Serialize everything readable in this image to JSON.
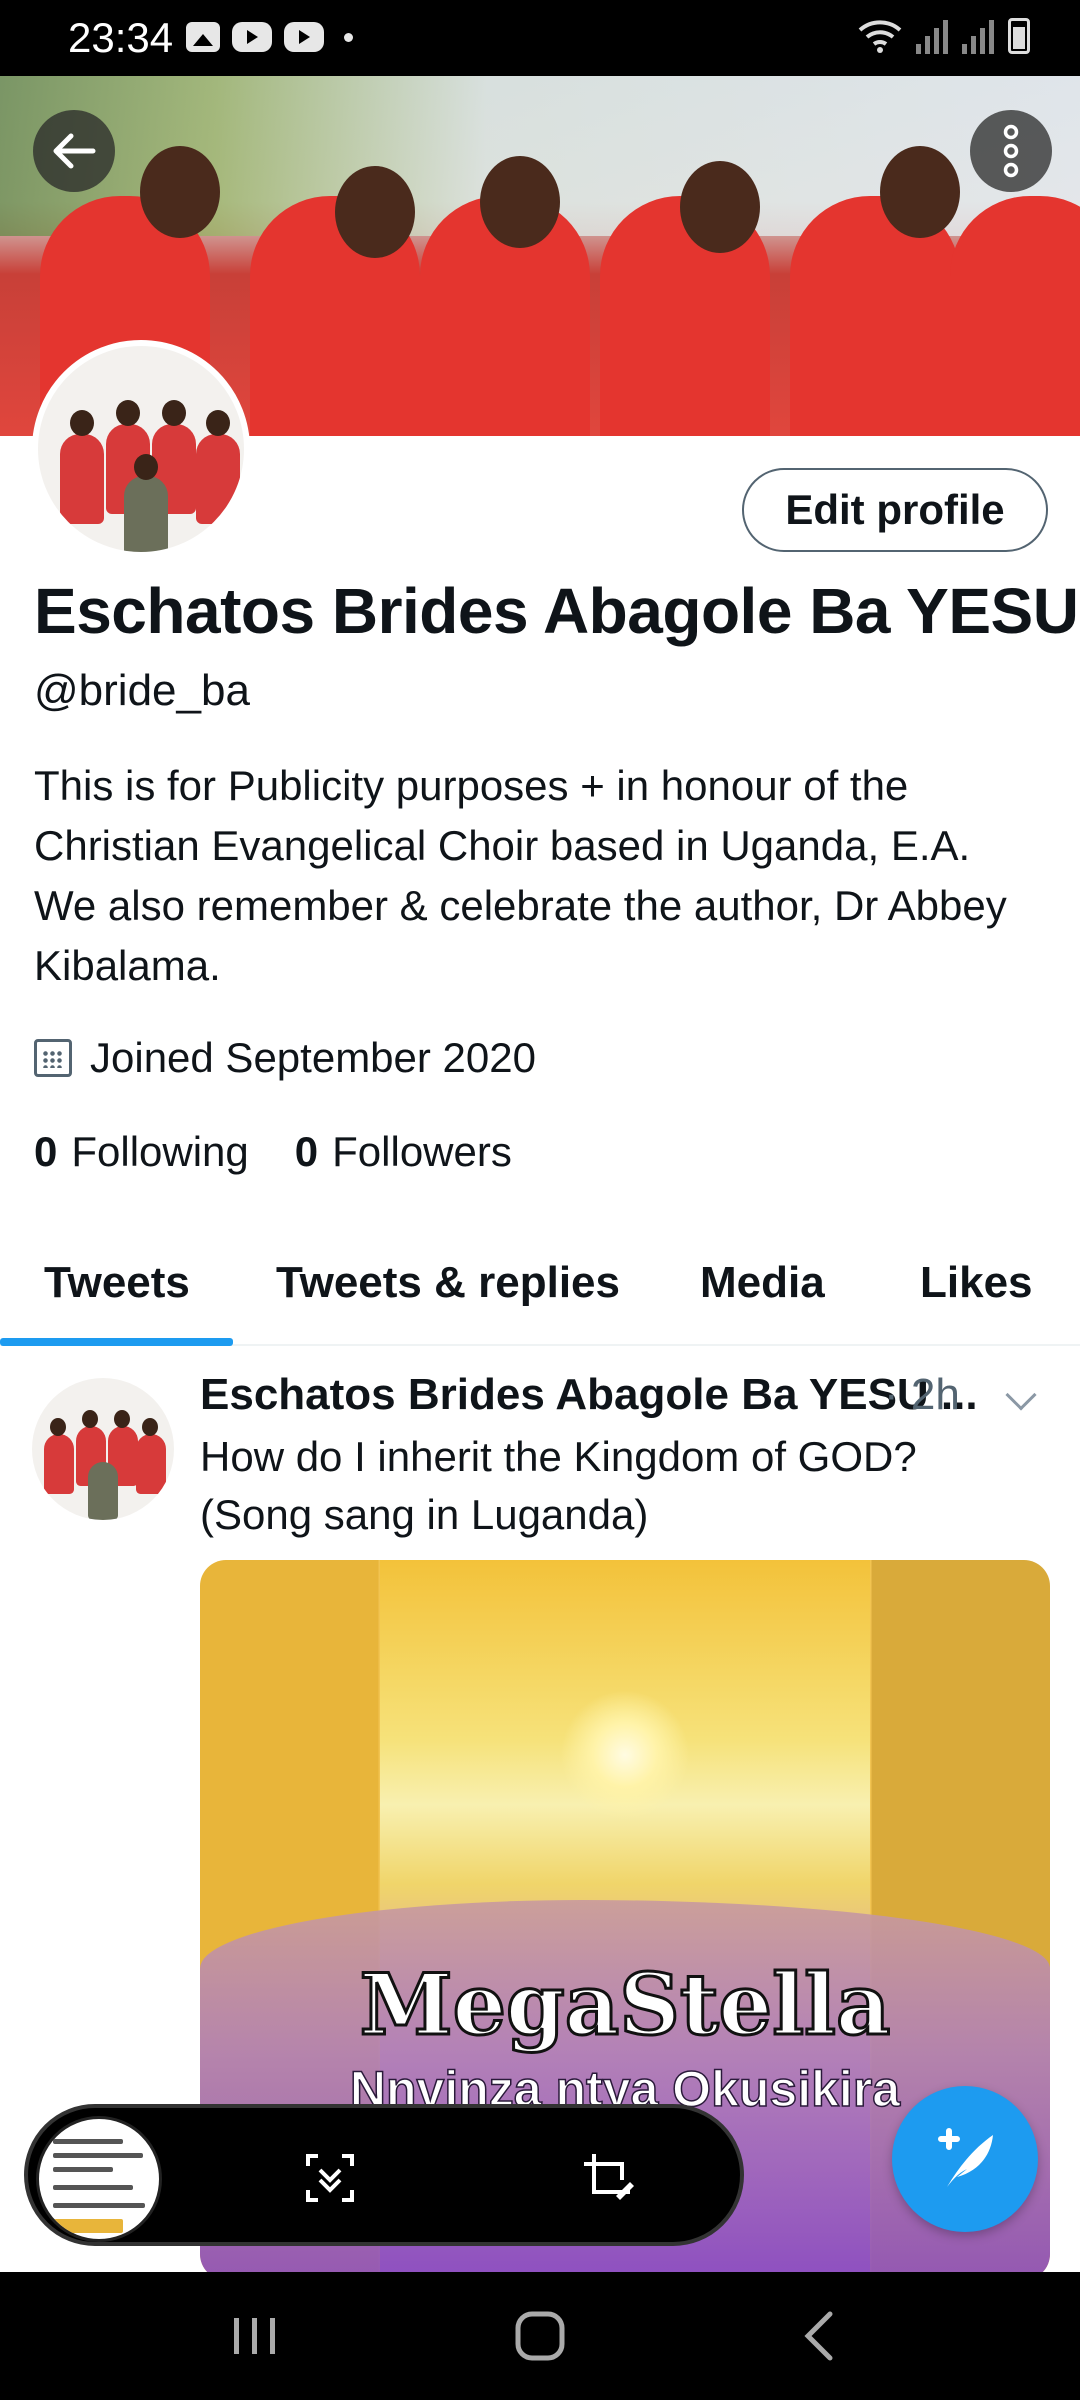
{
  "status_bar": {
    "time": "23:34"
  },
  "header": {
    "back_icon": "arrow-left-icon",
    "more_icon": "more-vertical-icon"
  },
  "profile": {
    "edit_profile_label": "Edit profile",
    "name": "Eschatos Brides Abagole Ba YESU",
    "handle": "@bride_ba",
    "bio": "This is for Publicity purposes + in honour of the Christian Evangelical Choir based in Uganda, E.A. We also remember & celebrate the author, Dr Abbey Kibalama.",
    "joined": "Joined September 2020",
    "following_count": "0",
    "following_label": "Following",
    "followers_count": "0",
    "followers_label": "Followers"
  },
  "tabs": [
    {
      "label": "Tweets",
      "selected": true
    },
    {
      "label": "Tweets & replies",
      "selected": false
    },
    {
      "label": "Media",
      "selected": false
    },
    {
      "label": "Likes",
      "selected": false
    }
  ],
  "tweet": {
    "author": "Eschatos Brides Abagole Ba YESU ...",
    "time": "· 2h",
    "text": "How do I inherit the Kingdom of GOD? (Song sang in Luganda)",
    "media_title": "MegaStella",
    "media_subtitle": "Nnvinza ntya Okusikira"
  },
  "colors": {
    "accent": "#1d9bf0",
    "text": "#0f1419",
    "secondary": "#536471"
  }
}
